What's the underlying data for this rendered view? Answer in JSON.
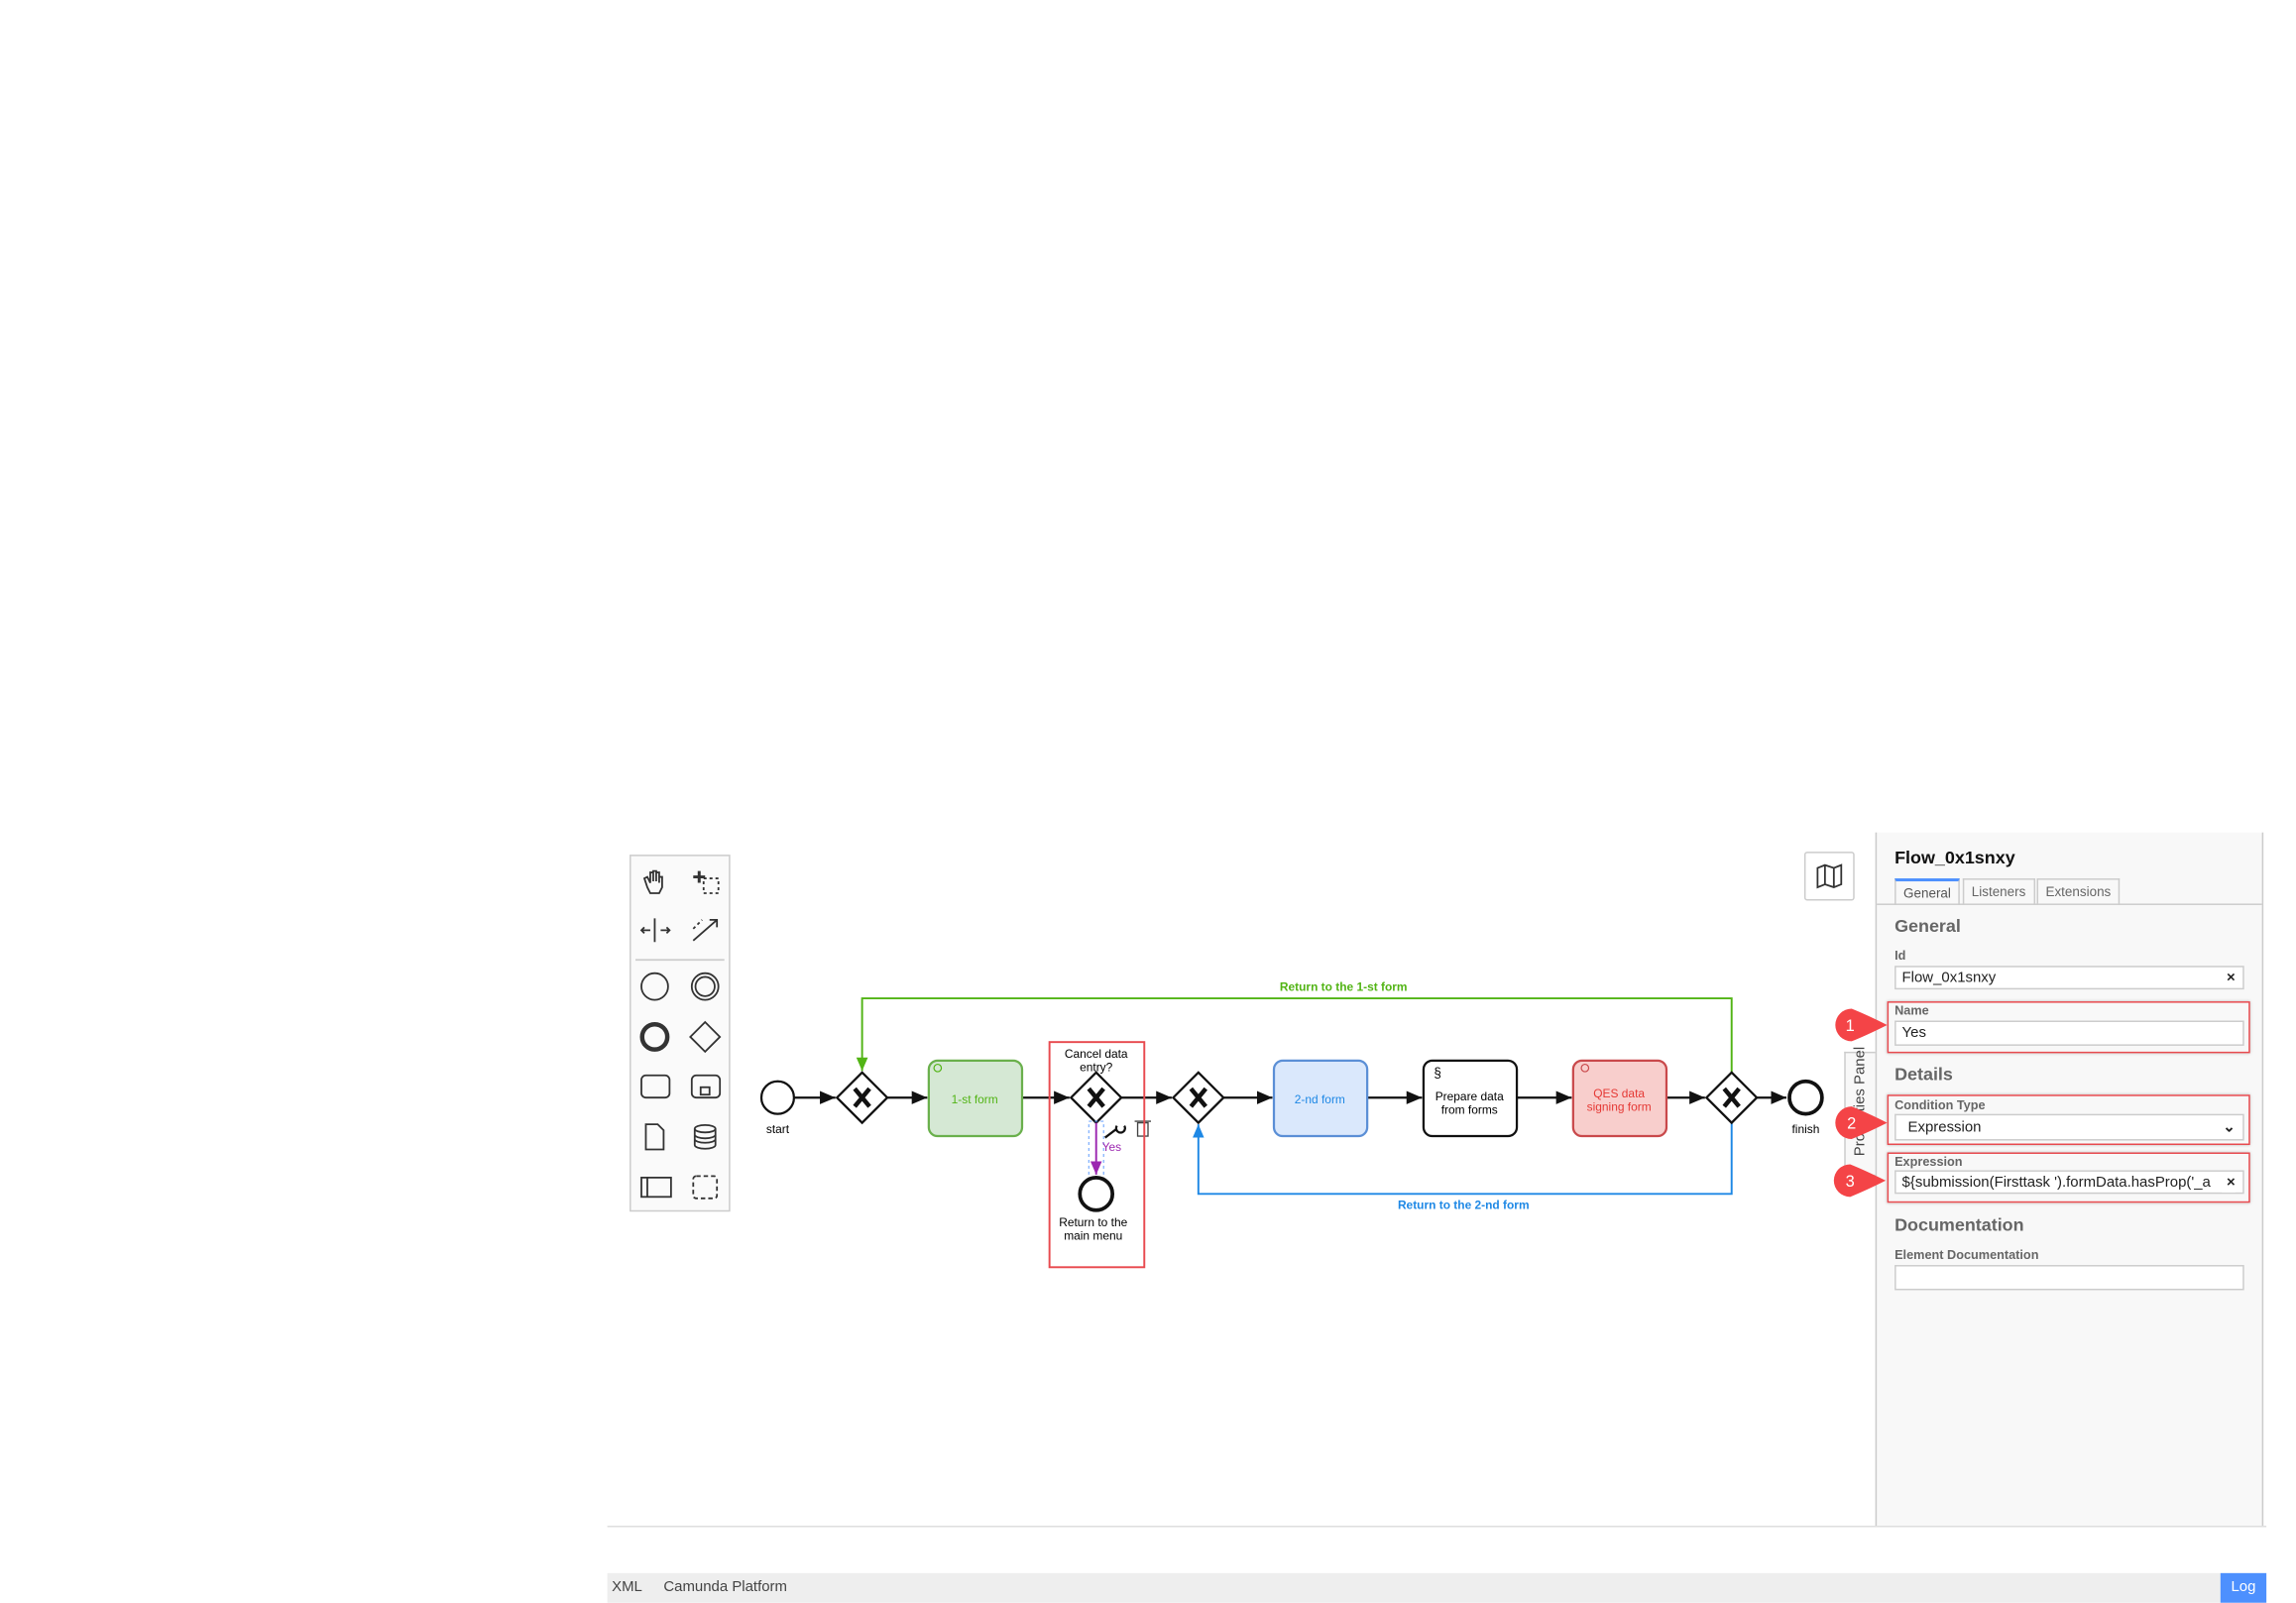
{
  "toolbar": {
    "icons": [
      "hand-tool-icon",
      "lasso-tool-icon",
      "space-tool-icon",
      "connect-tool-icon",
      "start-event-icon",
      "intermediate-event-icon",
      "end-event-icon",
      "gateway-icon",
      "task-icon",
      "subprocess-icon",
      "data-object-icon",
      "data-store-icon",
      "pool-icon",
      "group-icon"
    ]
  },
  "diagram": {
    "start_label": "start",
    "finish_label": "finish",
    "task1": "1-st form",
    "task2": "2-nd form",
    "task3_line1": "Prepare data",
    "task3_line2": "from forms",
    "task4_line1": "QES data",
    "task4_line2": "signing form",
    "gateway_label_line1": "Cancel data",
    "gateway_label_line2": "entry?",
    "end_label_line1": "Return to the",
    "end_label_line2": "main menu",
    "flow_yes": "Yes",
    "loop1": "Return to the 1-st form",
    "loop2": "Return to the 2-nd form",
    "colors": {
      "green": "#52b415",
      "blue": "#1e88e5",
      "red": "#e53935",
      "purple": "#9c27b0"
    }
  },
  "properties": {
    "toggle_label": "Properties Panel",
    "title": "Flow_0x1snxy",
    "tabs": [
      "General",
      "Listeners",
      "Extensions"
    ],
    "general_header": "General",
    "id_label": "Id",
    "id_value": "Flow_0x1snxy",
    "name_label": "Name",
    "name_value": "Yes",
    "details_header": "Details",
    "condition_type_label": "Condition Type",
    "condition_type_value": "Expression",
    "expression_label": "Expression",
    "expression_value": "${submission(Firsttask ').formData.hasProp('_a",
    "documentation_header": "Documentation",
    "element_doc_label": "Element Documentation",
    "element_doc_value": ""
  },
  "markers": [
    "1",
    "2",
    "3"
  ],
  "footer": {
    "xml": "XML",
    "platform": "Camunda Platform",
    "log": "Log"
  }
}
